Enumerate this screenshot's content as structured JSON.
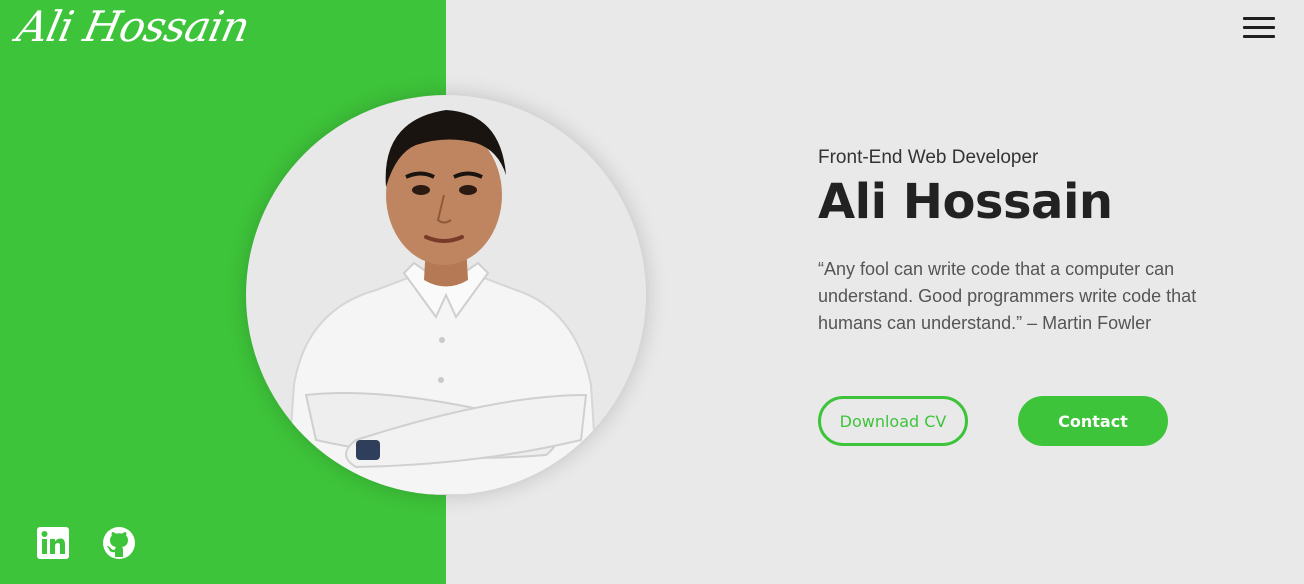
{
  "header": {
    "logo_text": "Ali Hossain",
    "menu_icon": "hamburger-menu-icon"
  },
  "hero": {
    "subtitle": "Front-End Web Developer",
    "name": "Ali Hossain",
    "quote": "“Any fool can write code that a computer can understand. Good programmers write code that humans can understand.” – Martin Fowler",
    "buttons": {
      "download_cv": "Download CV",
      "contact": "Contact"
    }
  },
  "portrait": {
    "description_icon": "profile-photo"
  },
  "social": [
    {
      "icon": "linkedin-icon"
    },
    {
      "icon": "github-icon"
    }
  ],
  "colors": {
    "accent": "#3ec43a",
    "background": "#e9e9e9",
    "heading": "#222222",
    "body_text": "#555555"
  }
}
